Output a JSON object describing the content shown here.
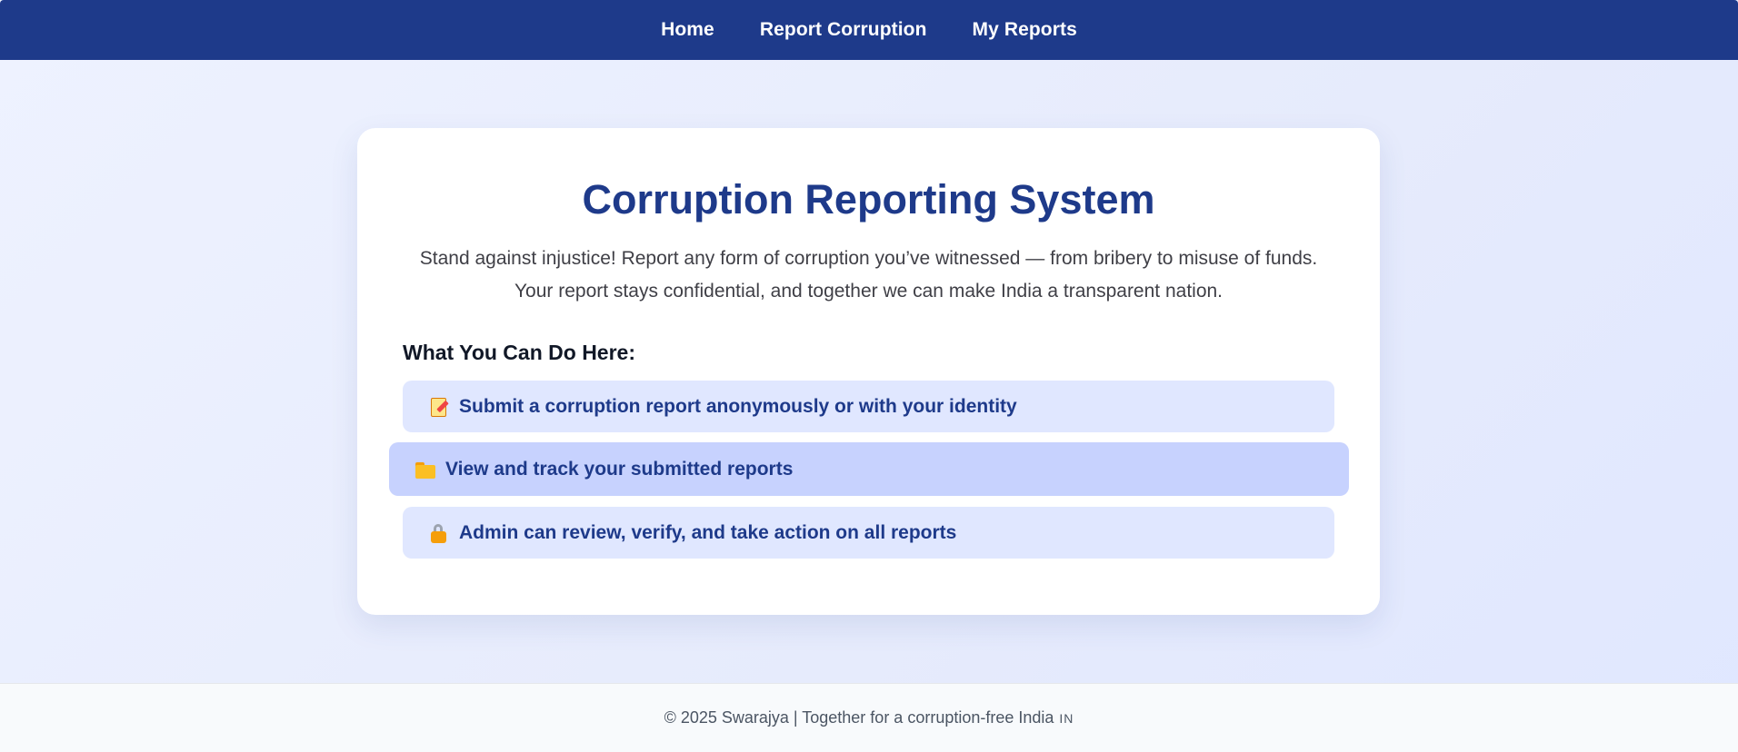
{
  "nav": {
    "items": [
      {
        "label": "Home"
      },
      {
        "label": "Report Corruption"
      },
      {
        "label": "My Reports"
      }
    ]
  },
  "card": {
    "title": "Corruption Reporting System",
    "description": "Stand against injustice! Report any form of corruption you’ve witnessed — from bribery to misuse of funds. Your report stays confidential, and together we can make India a transparent nation.",
    "section_heading": "What You Can Do Here:",
    "features": [
      {
        "icon": "memo-icon",
        "label": "Submit a corruption report anonymously or with your identity"
      },
      {
        "icon": "folder-icon",
        "label": "View and track your submitted reports",
        "highlighted": true
      },
      {
        "icon": "lock-icon",
        "label": "Admin can review, verify, and take action on all reports"
      }
    ]
  },
  "footer": {
    "text": "© 2025 Swarajya | Together for a corruption-free India",
    "flag": "IN"
  },
  "colors": {
    "primary": "#1e3a8a",
    "feature_bg": "#e0e7ff",
    "feature_highlight_bg": "#c7d2fe",
    "page_bg": "#eef2ff"
  }
}
